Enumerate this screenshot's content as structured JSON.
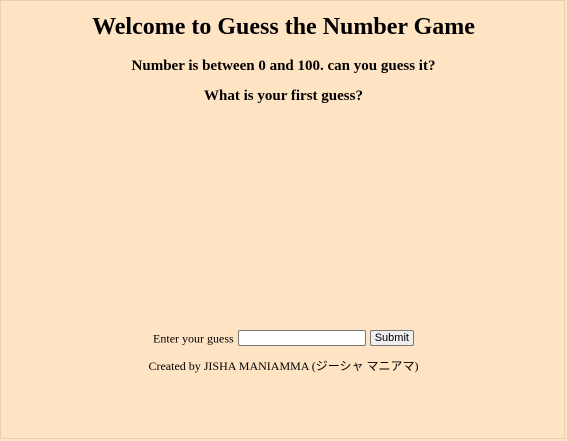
{
  "header": {
    "title": "Welcome to Guess the Number Game",
    "subtitle": "Number is between 0 and 100. can you guess it?",
    "prompt": "What is your first guess?"
  },
  "form": {
    "label": "Enter your guess",
    "input_value": "",
    "submit_label": "Submit"
  },
  "footer": {
    "credit": "Created by JISHA MANIAMMA (ジーシャ マニアマ)"
  },
  "colors": {
    "background": "#ffe4c4"
  }
}
